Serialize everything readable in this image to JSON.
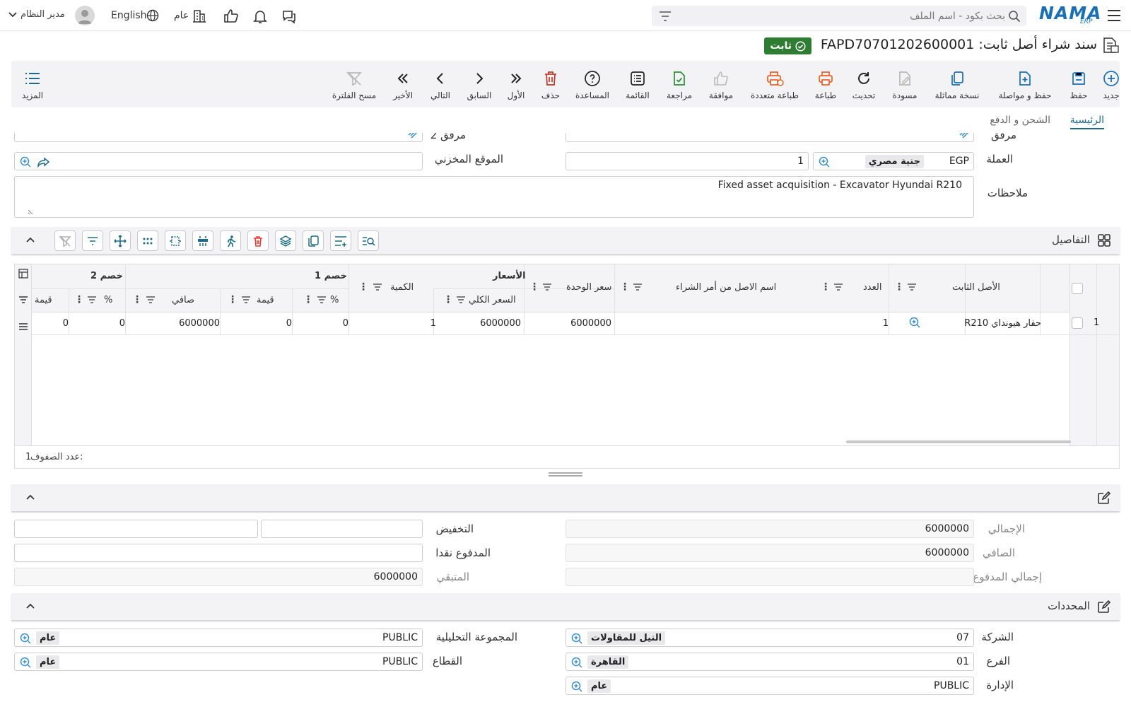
{
  "header": {
    "logo_text": "NAMA",
    "logo_sub": "ERP",
    "search_placeholder": "بحث بكود - اسم الملف",
    "user_name": "مدير النظام",
    "language": "English",
    "company": "عام"
  },
  "page": {
    "title": "سند شراء أصل ثابت: FAPD70701202600001",
    "status": "ثابت",
    "status_color": "#2e7d32"
  },
  "toolbar": {
    "new": "جديد",
    "save": "حفظ",
    "save_continue": "حفظ و مواصلة",
    "duplicate": "نسخة مماثلة",
    "draft": "مسودة",
    "refresh": "تحديث",
    "print": "طباعة",
    "multi_print": "طباعة متعددة",
    "approve": "موافقة",
    "review": "مراجعة",
    "list": "القائمة",
    "help": "المساعدة",
    "delete": "حذف",
    "first": "الأول",
    "previous": "السابق",
    "next": "التالي",
    "last": "الأخير",
    "clear_filter": "مسح الفلترة",
    "more": "المزيد"
  },
  "tabs": {
    "main": "الرئيسية",
    "shipping": "الشحن و الدفع"
  },
  "form": {
    "attachment_label": "مرفق",
    "attachment2_label": "مرفق 2",
    "currency_label": "العملة",
    "currency_code": "EGP",
    "currency_name": "جنية مصري",
    "rate": "1",
    "location_label": "الموقع المخزني",
    "notes_label": "ملاحظات",
    "notes": "Fixed asset acquisition - Excavator Hyundai R210"
  },
  "details": {
    "title": "التفاصيل",
    "headers": {
      "asset": "الأصل الثابت",
      "count": "العدد",
      "po_name": "اسم الاصل من أمر الشراء",
      "prices": "الأسعار",
      "unit_price": "سعر الوحدة",
      "total_price": "السعر الكلي",
      "quantity": "الكمية",
      "discount1": "خصم 1",
      "discount2": "خصم 2",
      "percent": "%",
      "value": "قيمة",
      "net": "صافي"
    },
    "rows": [
      {
        "num": "1",
        "asset": "حفار هيونداي R210",
        "count": "1",
        "po_name": "",
        "unit_price": "6000000",
        "total_price": "6000000",
        "quantity": "1",
        "d1_percent": "0",
        "d1_value": "0",
        "net": "6000000",
        "d2_percent": "0",
        "d2_value": "0"
      }
    ],
    "row_count_label": "عدد الصفوف:",
    "row_count": "1"
  },
  "totals": {
    "total_label": "الإجمالي",
    "total": "6000000",
    "net_label": "الصافي",
    "net": "6000000",
    "paid_total_label": "إجمالي المدفوع",
    "discount_label": "التخفيض",
    "cash_paid_label": "المدفوع نقدا",
    "remaining_label": "المتبقي",
    "remaining": "6000000"
  },
  "dimensions": {
    "title": "المحددات",
    "company_label": "الشركة",
    "company_code": "07",
    "company_name": "النيل للمقاولات",
    "branch_label": "الفرع",
    "branch_code": "01",
    "branch_name": "القاهرة",
    "department_label": "الإدارة",
    "department_code": "PUBLIC",
    "department_name": "عام",
    "analytic_label": "المجموعة التحليلية",
    "analytic_code": "PUBLIC",
    "analytic_name": "عام",
    "sector_label": "القطاع",
    "sector_code": "PUBLIC",
    "sector_name": "عام"
  }
}
